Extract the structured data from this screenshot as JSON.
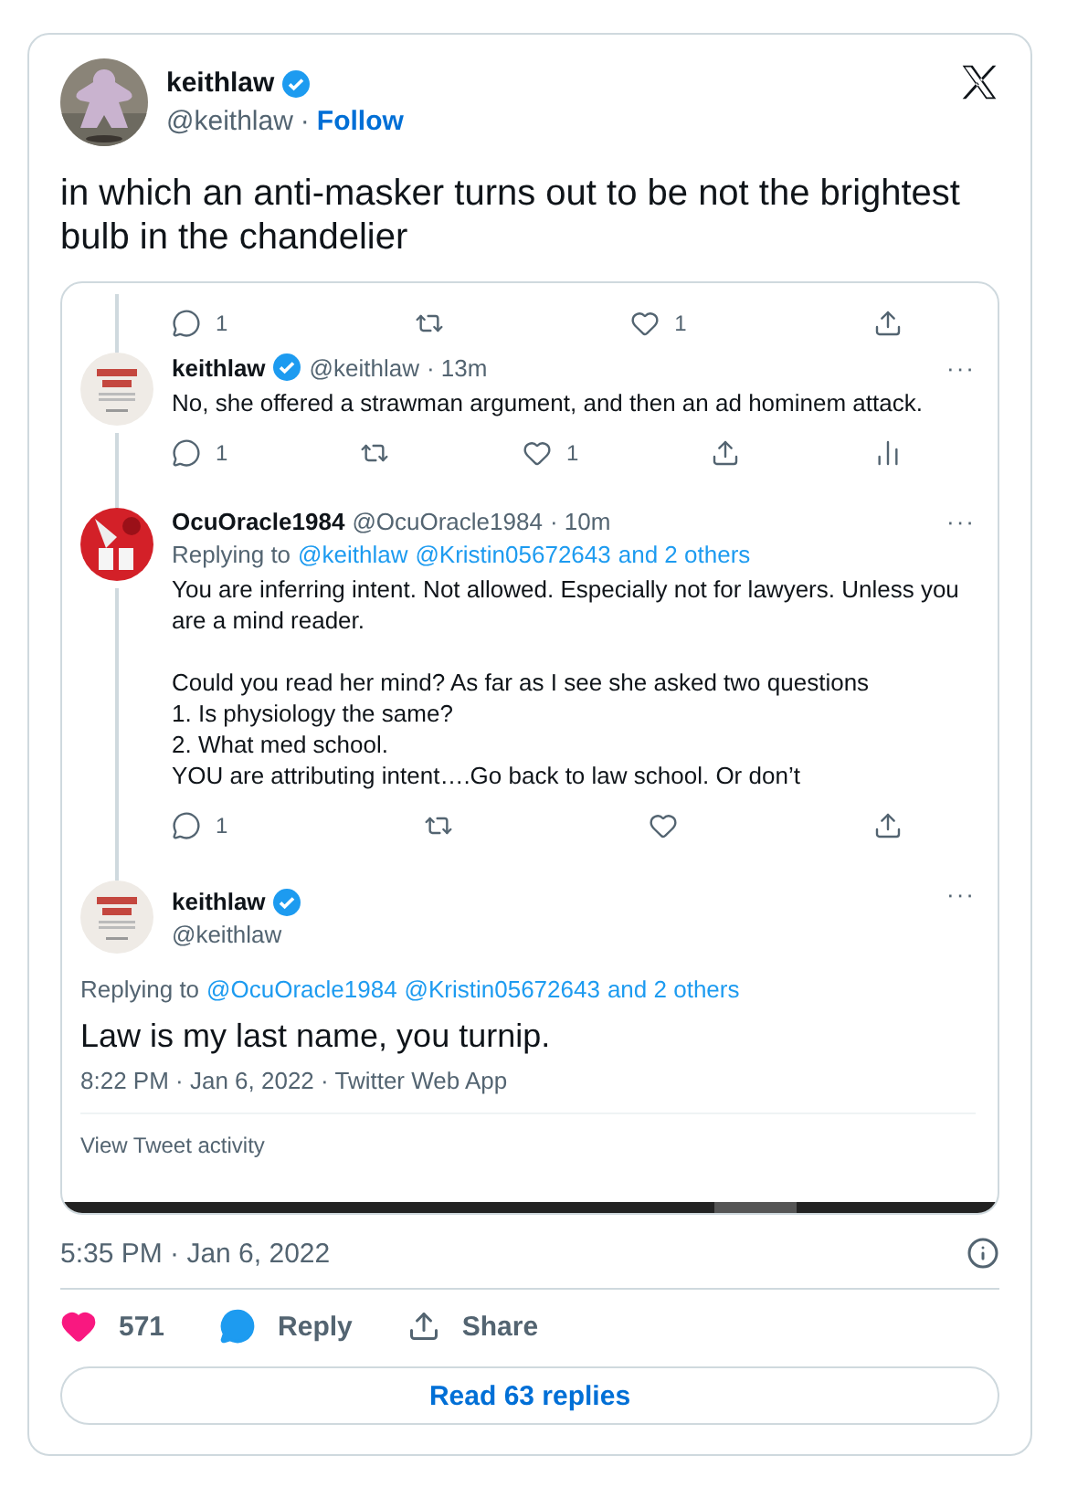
{
  "author": {
    "name": "keithlaw",
    "verified": true,
    "handle": "@keithlaw",
    "separator": "·",
    "follow": "Follow"
  },
  "text": "in which an anti-masker turns out to be not the brightest bulb in the chandelier",
  "embed": {
    "top_actions": [
      {
        "kind": "reply",
        "count": "1"
      },
      {
        "kind": "retweet"
      },
      {
        "kind": "like",
        "count": "1"
      },
      {
        "kind": "share"
      }
    ],
    "thread": [
      {
        "name": "keithlaw",
        "verified": true,
        "handle": "@keithlaw",
        "time": "· 13m",
        "more": "···",
        "paragraphs": [
          [
            "No, she offered a strawman argument, and then an ad hominem attack."
          ]
        ],
        "actions": [
          {
            "kind": "reply",
            "count": "1"
          },
          {
            "kind": "retweet"
          },
          {
            "kind": "like",
            "count": "1"
          },
          {
            "kind": "share"
          },
          {
            "kind": "analytics"
          }
        ]
      },
      {
        "name": "OcuOracle1984",
        "handle": "@OcuOracle1984",
        "time": "· 10m",
        "more": "···",
        "replying": {
          "prefix": "Replying to",
          "links": [
            "@keithlaw",
            "@Kristin05672643",
            "and 2 others"
          ]
        },
        "paragraphs": [
          [
            "You are inferring intent. Not allowed. Especially not for lawyers. Unless you are a mind reader."
          ],
          [
            "Could you read her mind? As far as I see she asked two questions",
            "1. Is physiology the same?",
            "2. What med school.",
            "YOU are attributing intent….Go back to law school. Or don’t"
          ]
        ],
        "actions": [
          {
            "kind": "reply",
            "count": "1"
          },
          {
            "kind": "retweet"
          },
          {
            "kind": "like"
          },
          {
            "kind": "share"
          }
        ]
      }
    ],
    "focal": {
      "name": "keithlaw",
      "verified": true,
      "handle": "@keithlaw",
      "more": "···",
      "replying": {
        "prefix": "Replying to",
        "links": [
          "@OcuOracle1984",
          "@Kristin05672643",
          "and 2 others"
        ]
      },
      "text": "Law is my last name, you turnip.",
      "meta": "8:22 PM · Jan 6, 2022 · Twitter Web App",
      "activity": "View Tweet activity"
    }
  },
  "timestamp": "5:35 PM · Jan 6, 2022",
  "actions": [
    {
      "kind": "like",
      "label": "571"
    },
    {
      "kind": "reply",
      "label": "Reply"
    },
    {
      "kind": "share",
      "label": "Share"
    }
  ],
  "read_replies": "Read 63 replies"
}
